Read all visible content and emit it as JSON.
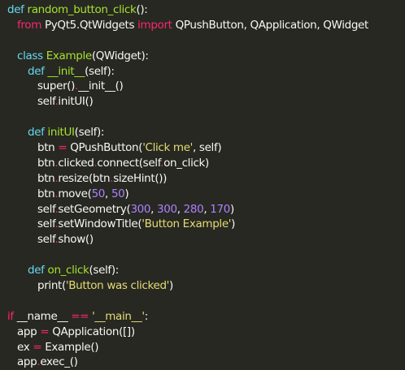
{
  "code": {
    "l1": {
      "def": "def",
      "name": "random_button_click",
      "rest": "():"
    },
    "l2": {
      "from": "from",
      "module": "PyQt5.QtWidgets",
      "import": "import",
      "names": "QPushButton, QApplication, QWidget"
    },
    "l4": {
      "class": "class",
      "name": "Example",
      "rest": "(QWidget):"
    },
    "l5": {
      "def": "def",
      "name": "__init__",
      "rest": "(self):"
    },
    "l6": {
      "a": "super()",
      "dot": ".",
      "b": "__init__",
      "c": "()"
    },
    "l7": {
      "a": "self",
      "dot": ".",
      "b": "initUI()"
    },
    "l9": {
      "def": "def",
      "name": "initUI",
      "rest": "(self):"
    },
    "l10": {
      "a": "btn ",
      "eq": "=",
      "b": " QPushButton(",
      "str": "'Click me'",
      "c": ", self)"
    },
    "l11": {
      "a": "btn",
      "d1": ".",
      "b": "clicked",
      "d2": ".",
      "c": "connect(self",
      "d3": ".",
      "e": "on_click)"
    },
    "l12": {
      "a": "btn",
      "d1": ".",
      "b": "resize(btn",
      "d2": ".",
      "c": "sizeHint())"
    },
    "l13": {
      "a": "btn",
      "d1": ".",
      "b": "move(",
      "n1": "50",
      "c": ", ",
      "n2": "50",
      "e": ")"
    },
    "l14": {
      "a": "self",
      "d1": ".",
      "b": "setGeometry(",
      "n1": "300",
      "c1": ", ",
      "n2": "300",
      "c2": ", ",
      "n3": "280",
      "c3": ", ",
      "n4": "170",
      "e": ")"
    },
    "l15": {
      "a": "self",
      "d1": ".",
      "b": "setWindowTitle(",
      "str": "'Button Example'",
      "e": ")"
    },
    "l16": {
      "a": "self",
      "d1": ".",
      "b": "show()"
    },
    "l18": {
      "def": "def",
      "name": "on_click",
      "rest": "(self):"
    },
    "l19": {
      "a": "print(",
      "str": "'Button was clicked'",
      "e": ")"
    },
    "l21": {
      "if": "if",
      "a": " __name__ ",
      "eq": "==",
      "str": " '__main__'",
      "e": ":"
    },
    "l22": {
      "a": "app ",
      "eq": "=",
      "b": " QApplication([])"
    },
    "l23": {
      "a": "ex ",
      "eq": "=",
      "b": " Example()"
    },
    "l24": {
      "a": "app",
      "d1": ".",
      "b": "exec_()"
    }
  },
  "colors": {
    "background": "#272822",
    "keyword": "#f92672",
    "storage": "#66d9ef",
    "function": "#a6e22e",
    "string": "#e6db74",
    "number": "#ae81ff",
    "text": "#f8f8f2"
  }
}
